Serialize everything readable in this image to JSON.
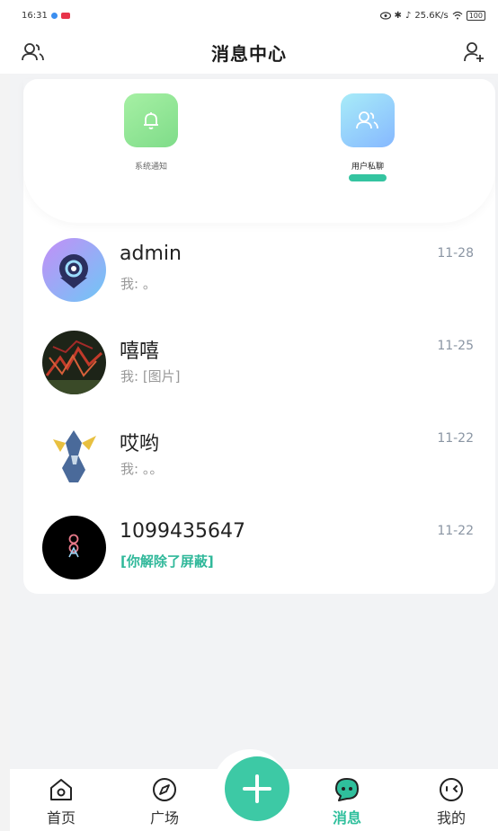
{
  "status_bar": {
    "time": "16:31",
    "net_speed": "25.6K/s",
    "battery": "100"
  },
  "header": {
    "title": "消息中心"
  },
  "quick_actions": [
    {
      "label": "系统通知",
      "icon": "bell-icon"
    },
    {
      "label": "用户私聊",
      "icon": "users-icon",
      "active": true
    }
  ],
  "conversations": [
    {
      "name": "admin",
      "preview": "我: 。",
      "date": "11-28"
    },
    {
      "name": "嘻嘻",
      "preview": "我: [图片]",
      "date": "11-25"
    },
    {
      "name": "哎哟",
      "preview": "我: 。。",
      "date": "11-22"
    },
    {
      "name": "1099435647",
      "preview": "[你解除了屏蔽]",
      "date": "11-22",
      "preview_accent": true
    }
  ],
  "tabs": [
    {
      "label": "首页",
      "icon": "home-icon"
    },
    {
      "label": "广场",
      "icon": "compass-icon"
    },
    {
      "label": "消息",
      "icon": "chat-icon",
      "active": true
    },
    {
      "label": "我的",
      "icon": "face-icon"
    }
  ],
  "colors": {
    "accent": "#3dc9a5",
    "background": "#f2f3f5"
  }
}
